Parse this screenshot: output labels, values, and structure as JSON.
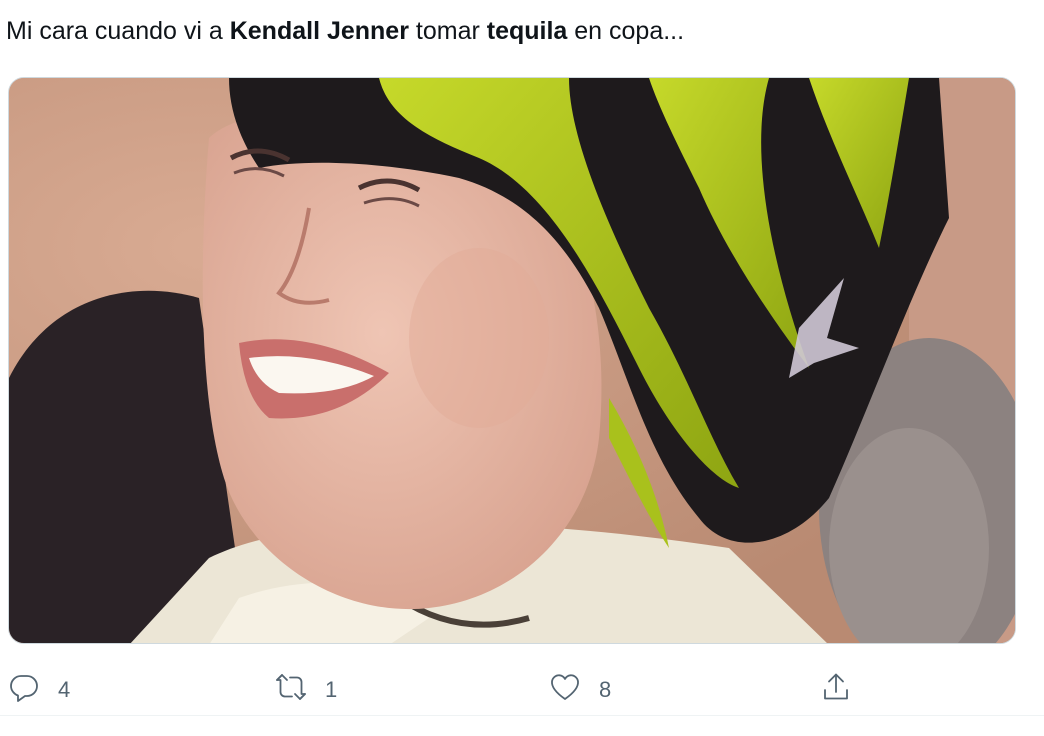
{
  "tweet": {
    "text_parts": [
      {
        "text": "Mi cara cuando vi a ",
        "bold": false
      },
      {
        "text": "Kendall Jenner",
        "bold": true
      },
      {
        "text": " tomar ",
        "bold": false
      },
      {
        "text": "tequila",
        "bold": true
      },
      {
        "text": " en copa...",
        "bold": false
      }
    ]
  },
  "actions": {
    "reply_count": "4",
    "retweet_count": "1",
    "like_count": "8"
  },
  "icons": {
    "reply": "reply-icon",
    "retweet": "retweet-icon",
    "like": "heart-icon",
    "share": "share-icon"
  },
  "colors": {
    "text": "#0f1419",
    "action_gray": "#536471",
    "media_border": "#cfd9de",
    "hair_green": "#b7cf1a"
  }
}
